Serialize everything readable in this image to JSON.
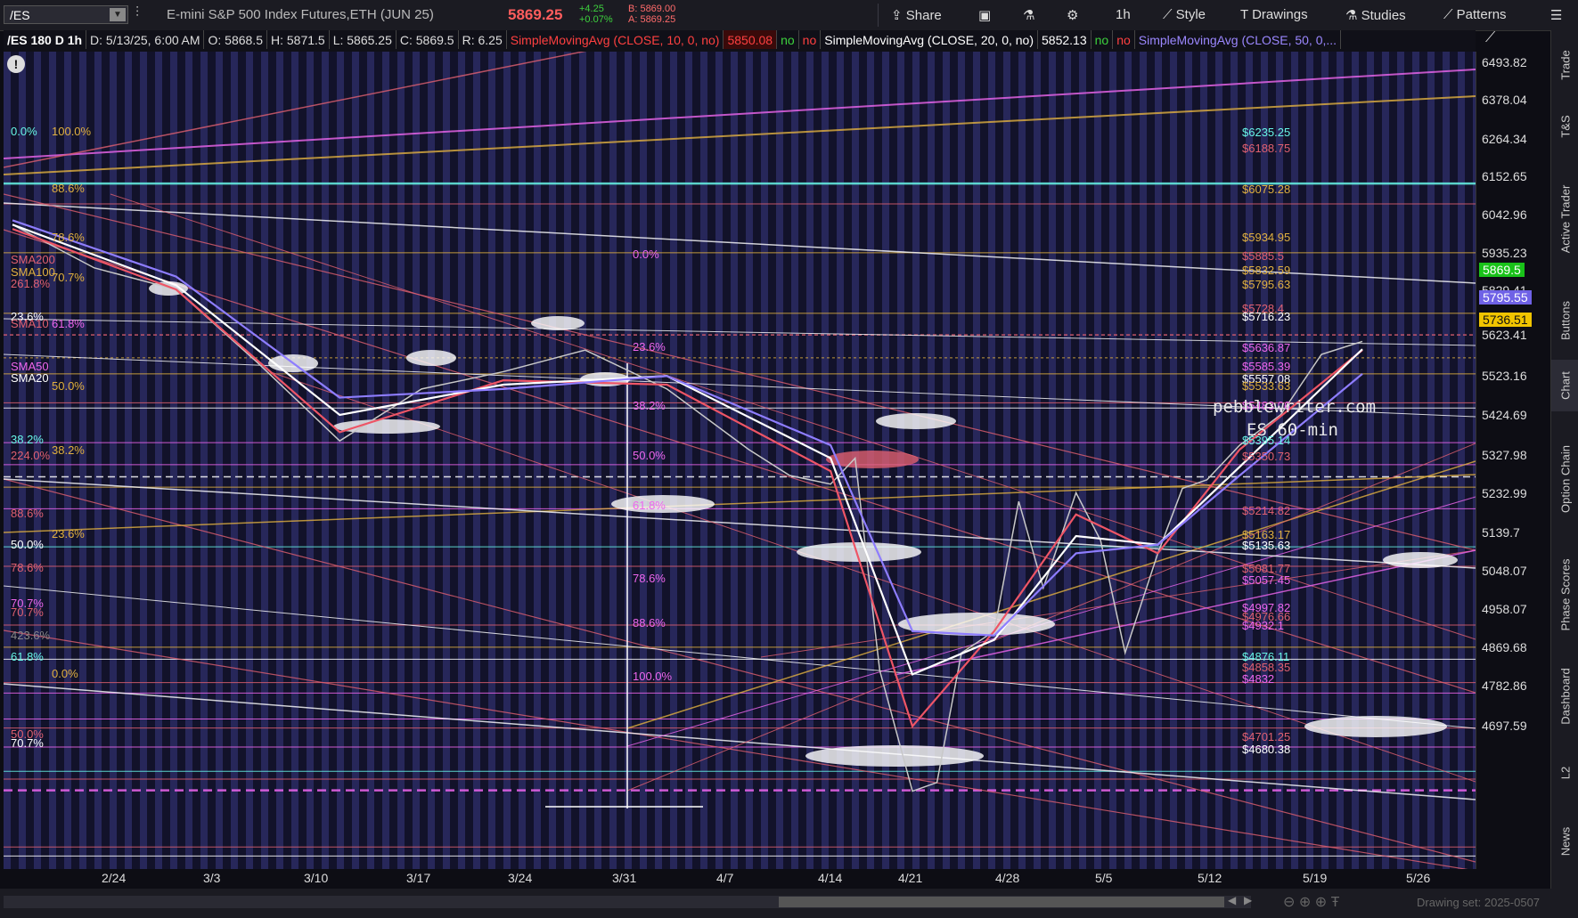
{
  "toolbar": {
    "symbol": "/ES",
    "symbol_dropdown_icon": "chevron-down-icon",
    "instrument_name": "E-mini S&P 500 Index Futures,ETH (JUN 25)",
    "last_price": "5869.25",
    "net_change": "+4.25",
    "pct_change": "+0.07%",
    "bid": "B: 5869.00",
    "ask": "A: 5869.25",
    "share_label": "Share",
    "timeframe_label": "1h",
    "style_label": "Style",
    "drawings_label": "Drawings",
    "studies_label": "Studies",
    "patterns_label": "Patterns"
  },
  "header": {
    "chart_symbol": "/ES 180 D 1h",
    "date": "D: 5/13/25, 6:00 AM",
    "open": "O: 5868.5",
    "high": "H: 5871.5",
    "low": "L: 5865.25",
    "close": "C: 5869.5",
    "range": "R: 6.25",
    "sma10_label": "SimpleMovingAvg (CLOSE, 10, 0, no)",
    "sma10_value": "5850.08",
    "no1": "no",
    "no2": "no",
    "sma20_label": "SimpleMovingAvg (CLOSE, 20, 0, no)",
    "sma20_value": "5852.13",
    "no3": "no",
    "no4": "no",
    "sma50_label": "SimpleMovingAvg (CLOSE, 50, 0,..."
  },
  "price_axis": {
    "ticks": [
      "6493.82",
      "6378.04",
      "6264.34",
      "6152.65",
      "6042.96",
      "5935.23",
      "5829.41",
      "5623.41",
      "5523.16",
      "5424.69",
      "5327.98",
      "5232.99",
      "5139.7",
      "5048.07",
      "4958.07",
      "4869.68",
      "4782.86",
      "4697.59"
    ],
    "badge_last": "5869.5",
    "badge_mid": "5795.55",
    "badge_low": "5736.51",
    "colors": {
      "last": "#19c219",
      "mid": "#6f62e6",
      "low": "#f0c400"
    }
  },
  "level_labels": [
    {
      "text": "$6235.25",
      "color": "#67f4e6"
    },
    {
      "text": "$6188.75",
      "color": "#e06070"
    },
    {
      "text": "$6075.28",
      "color": "#e0b040"
    },
    {
      "text": "$5934.95",
      "color": "#e0b040"
    },
    {
      "text": "$5885.5",
      "color": "#e06070"
    },
    {
      "text": "$5832.59",
      "color": "#e0b040"
    },
    {
      "text": "$5795.63",
      "color": "#e0b040"
    },
    {
      "text": "$5728.4",
      "color": "#e06070"
    },
    {
      "text": "$5716.23",
      "color": "#ffffff"
    },
    {
      "text": "$5636.87",
      "color": "#ee66ee"
    },
    {
      "text": "$5585.39",
      "color": "#ee66ee"
    },
    {
      "text": "$5557.08",
      "color": "#ffffff"
    },
    {
      "text": "$5533.63",
      "color": "#e0b040"
    },
    {
      "text": "$5483.06",
      "color": "#ee66ee"
    },
    {
      "text": "$5395.14",
      "color": "#67f4e6"
    },
    {
      "text": "$5350.73",
      "color": "#e06070"
    },
    {
      "text": "$5214.82",
      "color": "#e06070"
    },
    {
      "text": "$5163.17",
      "color": "#e0b040"
    },
    {
      "text": "$5135.63",
      "color": "#ffffff"
    },
    {
      "text": "$5081.77",
      "color": "#e06070"
    },
    {
      "text": "$5057.45",
      "color": "#ee66ee"
    },
    {
      "text": "$4997.82",
      "color": "#ee66ee"
    },
    {
      "text": "$4976.66",
      "color": "#e06070"
    },
    {
      "text": "$4932.1",
      "color": "#ee66ee"
    },
    {
      "text": "$4876.11",
      "color": "#67f4e6"
    },
    {
      "text": "$4858.35",
      "color": "#e06070"
    },
    {
      "text": "$4832",
      "color": "#ee66ee"
    },
    {
      "text": "$4701.25",
      "color": "#e06070"
    },
    {
      "text": "$4680.38",
      "color": "#ffffff"
    }
  ],
  "left_fib_labels": [
    {
      "text": "0.0%",
      "color": "#67f4e6"
    },
    {
      "text": "100.0%",
      "color": "#e0b040"
    },
    {
      "text": "88.6%",
      "color": "#e0b040"
    },
    {
      "text": "78.6%",
      "color": "#e0b040"
    },
    {
      "text": "SMA200",
      "color": "#e06070"
    },
    {
      "text": "SMA100",
      "color": "#e0b040"
    },
    {
      "text": "70.7%",
      "color": "#e0b040"
    },
    {
      "text": "261.8%",
      "color": "#e06070"
    },
    {
      "text": "23.6%",
      "color": "#ffffff"
    },
    {
      "text": "SMA10",
      "color": "#e06070"
    },
    {
      "text": "61.8%",
      "color": "#ee66ee"
    },
    {
      "text": "SMA50",
      "color": "#ee66ee"
    },
    {
      "text": "SMA20",
      "color": "#ffffff"
    },
    {
      "text": "50.0%",
      "color": "#e0b040"
    },
    {
      "text": "38.2%",
      "color": "#67f4e6"
    },
    {
      "text": "38.2%",
      "color": "#e0b040"
    },
    {
      "text": "224.0%",
      "color": "#e06070"
    },
    {
      "text": "88.6%",
      "color": "#e06070"
    },
    {
      "text": "23.6%",
      "color": "#e0b040"
    },
    {
      "text": "50.0%",
      "color": "#ffffff"
    },
    {
      "text": "78.6%",
      "color": "#e06070"
    },
    {
      "text": "70.7%",
      "color": "#ee66ee"
    },
    {
      "text": "70.7%",
      "color": "#e06070"
    },
    {
      "text": "423.6%",
      "color": "#888888"
    },
    {
      "text": "61.8%",
      "color": "#67f4e6"
    },
    {
      "text": "0.0%",
      "color": "#e0b040"
    },
    {
      "text": "50.0%",
      "color": "#e06070"
    },
    {
      "text": "70.7%",
      "color": "#ffffff"
    }
  ],
  "inner_fib_labels": [
    {
      "text": "0.0%",
      "color": "#ee66ee"
    },
    {
      "text": "23.6%",
      "color": "#ee66ee"
    },
    {
      "text": "38.2%",
      "color": "#ee66ee"
    },
    {
      "text": "50.0%",
      "color": "#ee66ee"
    },
    {
      "text": "61.8%",
      "color": "#ee66ee"
    },
    {
      "text": "78.6%",
      "color": "#ee66ee"
    },
    {
      "text": "88.6%",
      "color": "#ee66ee"
    },
    {
      "text": "100.0%",
      "color": "#ee66ee"
    }
  ],
  "watermark": {
    "line1": "pebblewriter.com",
    "line2": "ES 60-min"
  },
  "date_axis": [
    "2/24",
    "3/3",
    "3/10",
    "3/17",
    "3/24",
    "3/31",
    "4/7",
    "4/14",
    "4/21",
    "4/28",
    "5/5",
    "5/12",
    "5/19",
    "5/26"
  ],
  "side_tabs": [
    "Trade",
    "T&S",
    "Active Trader",
    "Buttons",
    "Chart",
    "Option Chain",
    "Phase Scores",
    "Dashboard",
    "L2",
    "News"
  ],
  "bottom": {
    "drawing_set": "Drawing set: 2025-0507"
  },
  "chart_data": {
    "type": "line",
    "ylim": [
      4650,
      6540
    ],
    "series": [
      {
        "name": "price",
        "color": "#c8c8c8",
        "x": [
          0,
          10,
          20,
          30,
          40,
          50,
          60,
          70,
          80,
          90,
          95,
          100,
          103,
          106,
          110,
          113,
          116,
          120,
          123,
          126,
          130,
          133,
          136,
          140,
          143,
          146,
          150,
          155,
          160,
          165
        ],
        "values": [
          6140,
          6040,
          5990,
          5820,
          5640,
          5760,
          5800,
          5850,
          5760,
          5620,
          5560,
          5540,
          5600,
          5110,
          4830,
          4850,
          5150,
          5200,
          5500,
          5300,
          5520,
          5410,
          5150,
          5380,
          5530,
          5550,
          5630,
          5700,
          5840,
          5870
        ]
      },
      {
        "name": "SMA10",
        "color": "#ee5566",
        "x": [
          0,
          20,
          40,
          60,
          80,
          100,
          110,
          120,
          130,
          140,
          150,
          165
        ],
        "values": [
          6130,
          5990,
          5660,
          5780,
          5770,
          5570,
          4980,
          5200,
          5470,
          5380,
          5620,
          5850
        ]
      },
      {
        "name": "SMA20",
        "color": "#ffffff",
        "x": [
          0,
          20,
          40,
          60,
          80,
          100,
          110,
          120,
          130,
          140,
          150,
          165
        ],
        "values": [
          6140,
          6000,
          5700,
          5770,
          5790,
          5600,
          5100,
          5180,
          5420,
          5400,
          5580,
          5852
        ]
      },
      {
        "name": "SMA50",
        "color": "#8e7dff",
        "x": [
          0,
          20,
          40,
          60,
          80,
          100,
          110,
          120,
          130,
          140,
          150,
          165
        ],
        "values": [
          6150,
          6020,
          5740,
          5760,
          5790,
          5630,
          5200,
          5190,
          5380,
          5400,
          5560,
          5795
        ]
      }
    ]
  }
}
